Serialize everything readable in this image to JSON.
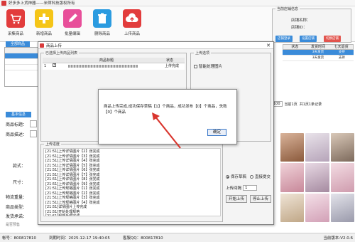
{
  "app": {
    "title": "好多多上货神器——米筛科技版权所有"
  },
  "toolbar": {
    "items": [
      {
        "label": "采集商品",
        "icon": "cart-icon",
        "color": "#e23c3c"
      },
      {
        "label": "新增商品",
        "icon": "plus-icon",
        "color": "#f5c518"
      },
      {
        "label": "批量编辑",
        "icon": "pencil-icon",
        "color": "#e84f9a"
      },
      {
        "label": "删除商品",
        "icon": "trash-icon",
        "color": "#2b9be0"
      },
      {
        "label": "上传商品",
        "icon": "cloud-upload-icon",
        "color": "#e23c3c"
      }
    ]
  },
  "store": {
    "legend": "当前店铺信息",
    "name_label": "店铺名称：",
    "id_label": "店铺ID：",
    "buttons": [
      "店铺登录",
      "设置店铺",
      "切换店铺"
    ]
  },
  "left": {
    "tab": "全部商品",
    "rows": [
      "",
      "",
      ""
    ],
    "detail_tab": "基本信息",
    "fields": [
      "商品标题：",
      "商品描述：",
      "款式：",
      "尺寸：",
      "物流重量：",
      "商品类型：",
      "发货承诺："
    ],
    "field_hint": "是否预售"
  },
  "grid": {
    "headers": [
      "状态",
      "发货时间",
      "七天退货"
    ],
    "rows": [
      [
        "",
        "3天发货",
        "支持"
      ],
      [
        "",
        "3天发货",
        "支持"
      ]
    ]
  },
  "pager": {
    "size": "100",
    "page": "当前1页",
    "total": "共1页1条记录"
  },
  "dialog": {
    "title": "商品上传",
    "list_legend": "已选择上传商品列表",
    "col_title": "商品标题",
    "col_status": "状态",
    "row_index": "1",
    "row_status": "上传完成",
    "options_legend": "上传选项",
    "smart_image": "智能处理图片",
    "progress_legend": "上传进度",
    "log": [
      "[21:51]上传详情图片【2】张完成",
      "[21:51]上传详情图片【3】张完成",
      "[21:51]上传详情图片【4】张完成",
      "[21:51]上传详情图片【5】张完成",
      "[21:51]上传详情图片【6】张完成",
      "[21:51]上传详情图片【7】张完成",
      "[21:51]上传详情图片【8】张完成",
      "[21:51]上传详情图片【9】张完成",
      "[21:51]上传规格图片【1】张完成",
      "[21:51]上传规格图片【2】张完成",
      "[21:51]上传规格图片【3】张完成",
      "[21:51]上传规格图片【4】张完成",
      "[21:51]详情图片上传完成",
      "[21:51]开始处理规格",
      "[21:51]规格处理完成",
      "[21:51]规格SKU处理完成",
      "[21:51]SKU处理完成",
      "[21:51]SKU完成",
      "[21:51]商品已创建完成",
      "[21:51]商品【1】保存草稿成功",
      "[21:51]商品上传完成"
    ],
    "radio_draft": "保存草稿",
    "radio_submit": "直接提交",
    "interval_label": "上传间隔",
    "interval_value": "1",
    "start_button": "开始上传",
    "stop_button": "停止上传"
  },
  "message": {
    "text": "商品上传完成,成功保存草稿【1】个商品，成功发布【0】个商品，失败【0】个商品",
    "ok": "确定"
  },
  "status": {
    "account": "帐号：800817810",
    "expire": "到期时间：2025-12-17 19:40:05",
    "qq": "客服QQ：800817810",
    "version": "当前版本:V2.0.6"
  },
  "colors": {
    "accent": "#3a8bd9",
    "arrow": "#d9362e"
  }
}
